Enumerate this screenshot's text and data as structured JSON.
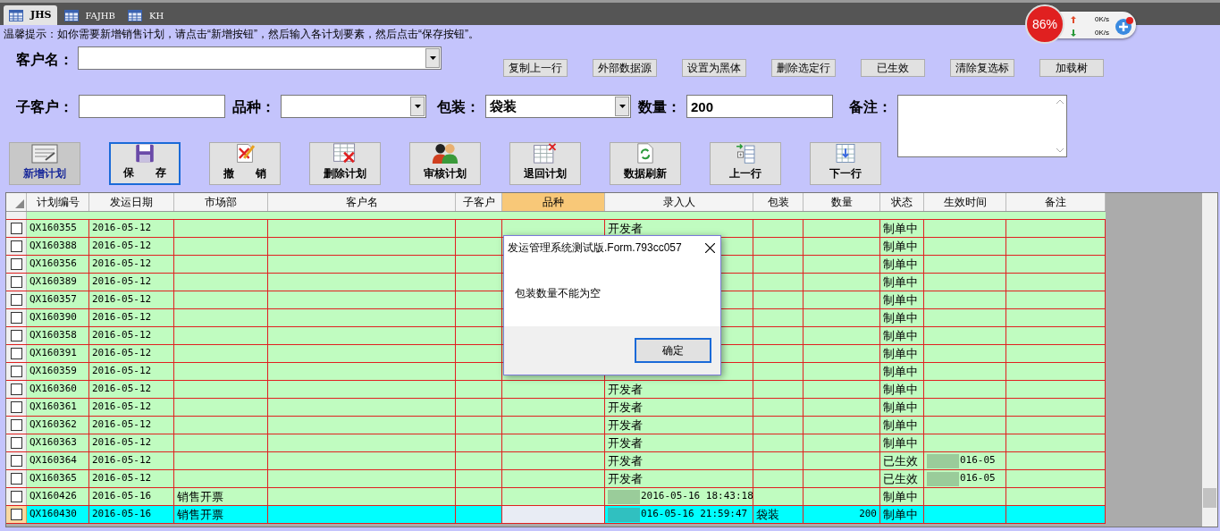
{
  "tabs": [
    {
      "label": "JHS",
      "selected": true
    },
    {
      "label": "FAJHB",
      "selected": false
    },
    {
      "label": "KH",
      "selected": false
    }
  ],
  "net_widget": {
    "percent": "86%",
    "upload": "0K/s",
    "download": "0K/s"
  },
  "hint": "温馨提示：如你需要新增销售计划，请点击“新增按钮”，然后输入各计划要素，然后点击“保存按钮”。",
  "form": {
    "customer": {
      "label": "客户名："
    },
    "sub_customer": {
      "label": "子客户："
    },
    "variety": {
      "label": "品种："
    },
    "packaging": {
      "label": "包装：",
      "value": "袋装"
    },
    "quantity": {
      "label": "数量：",
      "value": "200"
    },
    "remark": {
      "label": "备注："
    }
  },
  "action_buttons": [
    "复制上一行",
    "外部数据源",
    "设置为黑体",
    "删除选定行",
    "已生效",
    "清除复选标",
    "加载树"
  ],
  "toolbar": [
    {
      "label": "新增计划",
      "disabled": true,
      "focused": false
    },
    {
      "label": "保　　存",
      "disabled": false,
      "focused": true
    },
    {
      "label": "撤　　销",
      "disabled": false,
      "focused": false
    },
    {
      "label": "删除计划",
      "disabled": false,
      "focused": false
    },
    {
      "label": "审核计划",
      "disabled": false,
      "focused": false
    },
    {
      "label": "退回计划",
      "disabled": false,
      "focused": false
    },
    {
      "label": "数据刷新",
      "disabled": false,
      "focused": false
    },
    {
      "label": "上一行",
      "disabled": false,
      "focused": false
    },
    {
      "label": "下一行",
      "disabled": false,
      "focused": false
    }
  ],
  "table": {
    "columns": [
      "计划编号",
      "发运日期",
      "市场部",
      "客户名",
      "子客户",
      "品种",
      "录入人",
      "包装",
      "数量",
      "状态",
      "生效时间",
      "备注"
    ],
    "rows": [
      {
        "checked": false,
        "selected": false,
        "cells": [
          "QX160355",
          "2016-05-12",
          "",
          "",
          "",
          "",
          "开发者",
          "",
          "",
          "制单中",
          "",
          ""
        ]
      },
      {
        "checked": false,
        "selected": false,
        "cells": [
          "QX160388",
          "2016-05-12",
          "",
          "",
          "",
          "",
          "",
          "",
          "",
          "制单中",
          "",
          ""
        ]
      },
      {
        "checked": false,
        "selected": false,
        "cells": [
          "QX160356",
          "2016-05-12",
          "",
          "",
          "",
          "",
          "",
          "",
          "",
          "制单中",
          "",
          ""
        ]
      },
      {
        "checked": false,
        "selected": false,
        "cells": [
          "QX160389",
          "2016-05-12",
          "",
          "",
          "",
          "",
          "",
          "",
          "",
          "制单中",
          "",
          ""
        ]
      },
      {
        "checked": false,
        "selected": false,
        "cells": [
          "QX160357",
          "2016-05-12",
          "",
          "",
          "",
          "",
          "",
          "",
          "",
          "制单中",
          "",
          ""
        ]
      },
      {
        "checked": false,
        "selected": false,
        "cells": [
          "QX160390",
          "2016-05-12",
          "",
          "",
          "",
          "",
          "",
          "",
          "",
          "制单中",
          "",
          ""
        ]
      },
      {
        "checked": false,
        "selected": false,
        "cells": [
          "QX160358",
          "2016-05-12",
          "",
          "",
          "",
          "",
          "",
          "",
          "",
          "制单中",
          "",
          ""
        ]
      },
      {
        "checked": false,
        "selected": false,
        "cells": [
          "QX160391",
          "2016-05-12",
          "",
          "",
          "",
          "",
          "",
          "",
          "",
          "制单中",
          "",
          ""
        ]
      },
      {
        "checked": false,
        "selected": false,
        "cells": [
          "QX160359",
          "2016-05-12",
          "",
          "",
          "",
          "",
          "",
          "",
          "",
          "制单中",
          "",
          ""
        ]
      },
      {
        "checked": false,
        "selected": false,
        "cells": [
          "QX160360",
          "2016-05-12",
          "",
          "",
          "",
          "",
          "开发者",
          "",
          "",
          "制单中",
          "",
          ""
        ]
      },
      {
        "checked": false,
        "selected": false,
        "cells": [
          "QX160361",
          "2016-05-12",
          "",
          "",
          "",
          "",
          "开发者",
          "",
          "",
          "制单中",
          "",
          ""
        ]
      },
      {
        "checked": false,
        "selected": false,
        "cells": [
          "QX160362",
          "2016-05-12",
          "",
          "",
          "",
          "",
          "开发者",
          "",
          "",
          "制单中",
          "",
          ""
        ]
      },
      {
        "checked": false,
        "selected": false,
        "cells": [
          "QX160363",
          "2016-05-12",
          "",
          "",
          "",
          "",
          "开发者",
          "",
          "",
          "制单中",
          "",
          ""
        ]
      },
      {
        "checked": false,
        "selected": false,
        "cells": [
          "QX160364",
          "2016-05-12",
          "",
          "",
          "",
          "",
          "开发者",
          "",
          "",
          "已生效",
          {
            "text": "016-05",
            "masked": true
          },
          ""
        ]
      },
      {
        "checked": false,
        "selected": false,
        "cells": [
          "QX160365",
          "2016-05-12",
          "",
          "",
          "",
          "",
          "开发者",
          "",
          "",
          "已生效",
          {
            "text": "016-05",
            "masked": true
          },
          ""
        ]
      },
      {
        "checked": false,
        "selected": false,
        "cells": [
          "QX160426",
          "2016-05-16",
          "销售开票",
          "",
          "",
          "",
          {
            "text": "2016-05-16 18:43:18",
            "masked": true
          },
          "",
          "",
          "制单中",
          "",
          ""
        ]
      },
      {
        "checked": false,
        "selected": true,
        "cells": [
          "QX160430",
          "2016-05-16",
          "销售开票",
          "",
          "",
          "",
          {
            "text": "016-05-16 21:59:47",
            "masked": true
          },
          "袋装",
          "200",
          "制单中",
          "",
          ""
        ]
      }
    ]
  },
  "dialog": {
    "title": "发运管理系统测试版.Form.793cc057",
    "message": "包装数量不能为空",
    "button": "确定"
  }
}
